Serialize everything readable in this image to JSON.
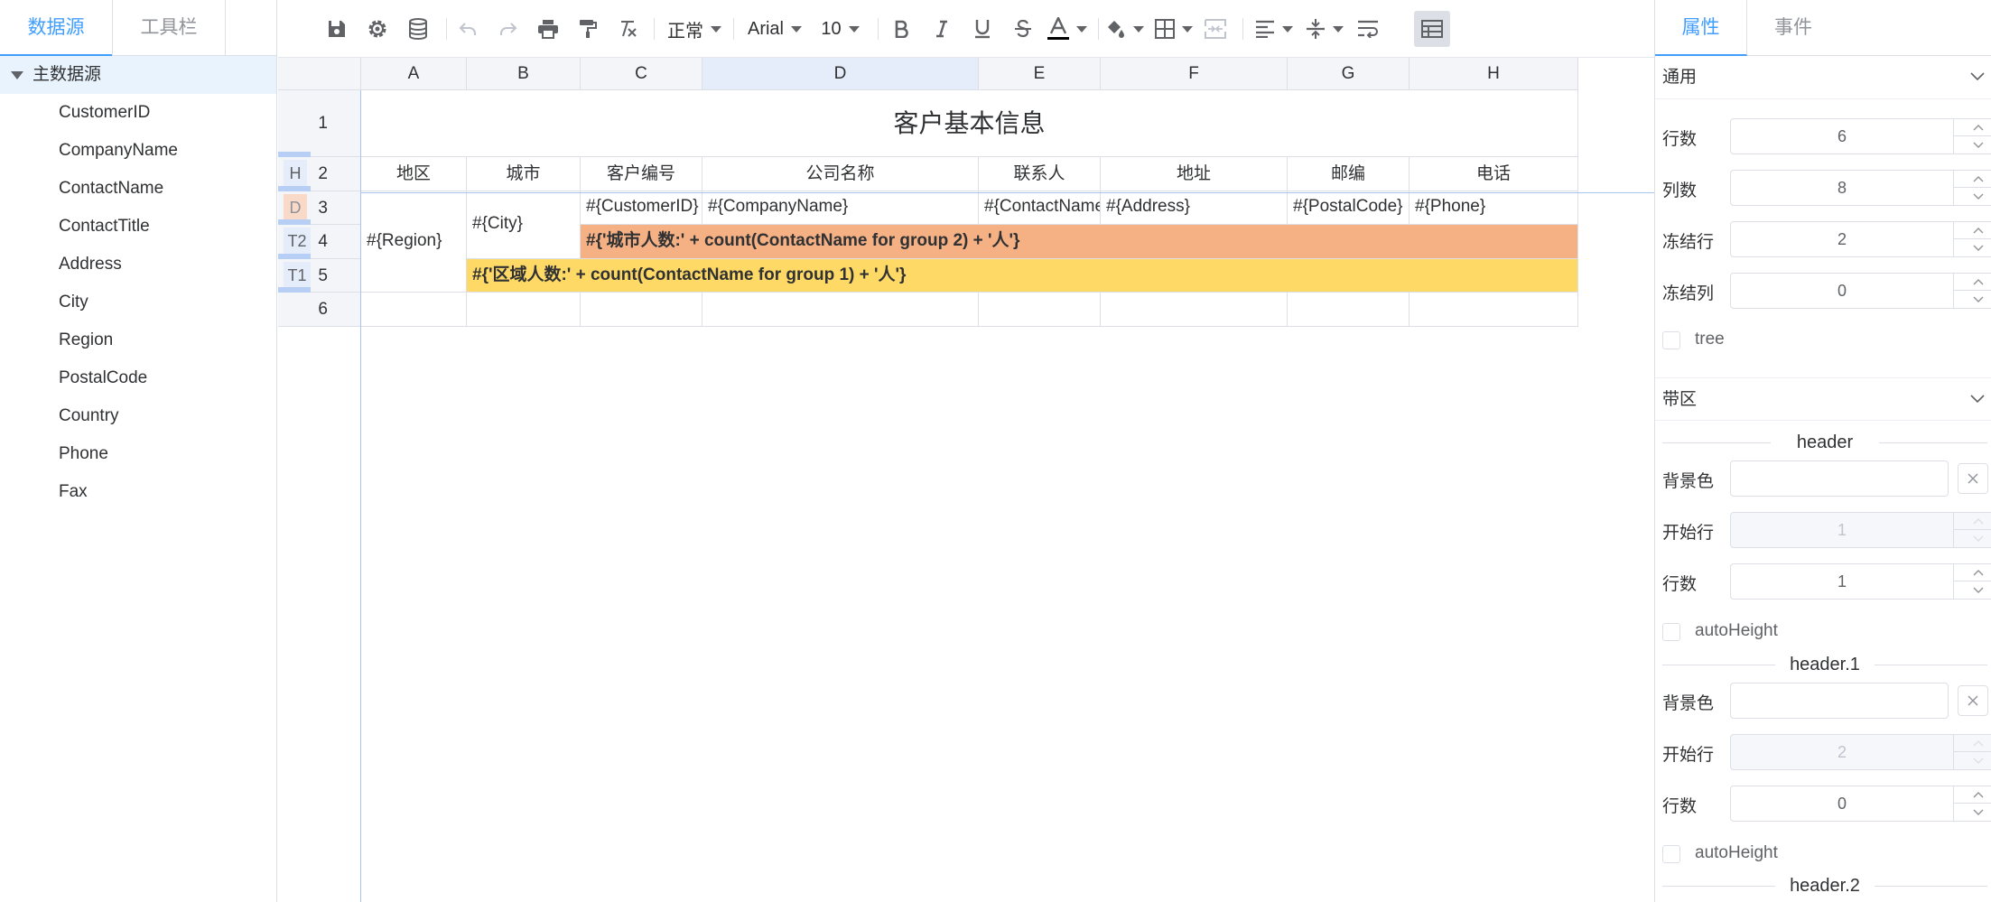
{
  "left_panel": {
    "tabs": [
      "数据源",
      "工具栏"
    ],
    "tree_root": "主数据源",
    "fields": [
      "CustomerID",
      "CompanyName",
      "ContactName",
      "ContactTitle",
      "Address",
      "City",
      "Region",
      "PostalCode",
      "Country",
      "Phone",
      "Fax"
    ]
  },
  "toolbar": {
    "format": "正常",
    "font": "Arial",
    "font_size": "10",
    "font_color": "#000000"
  },
  "sheet": {
    "columns": [
      "A",
      "B",
      "C",
      "D",
      "E",
      "F",
      "G",
      "H"
    ],
    "rows": [
      "1",
      "2",
      "3",
      "4",
      "5",
      "6"
    ],
    "bands": {
      "r2": "H",
      "r3": "D",
      "r4": "T2",
      "r5": "T1"
    },
    "title": "客户基本信息",
    "headers": [
      "地区",
      "城市",
      "客户编号",
      "公司名称",
      "联系人",
      "地址",
      "邮编",
      "电话"
    ],
    "detail": {
      "region": "#{Region}",
      "city": "#{City}",
      "customer_id": "#{CustomerID}",
      "company": "#{CompanyName}",
      "contact": "#{ContactName}",
      "address": "#{Address}",
      "postal": "#{PostalCode}",
      "phone": "#{Phone}"
    },
    "group2_total": "#{'城市人数:' + count(ContactName for group 2) + '人'}",
    "group1_total": "#{'区域人数:' + count(ContactName for group 1) + '人'}",
    "colors": {
      "group2_bg": "#f5b084",
      "group1_bg": "#ffd966",
      "band_d": "#f9d9c8"
    }
  },
  "right_panel": {
    "tabs": [
      "属性",
      "事件"
    ],
    "general": {
      "title": "通用",
      "rows_label": "行数",
      "rows_value": "6",
      "cols_label": "列数",
      "cols_value": "8",
      "frozen_rows_label": "冻结行",
      "frozen_rows_value": "2",
      "frozen_cols_label": "冻结列",
      "frozen_cols_value": "0",
      "tree_label": "tree"
    },
    "bands": {
      "title": "带区",
      "header": {
        "name": "header",
        "bg_label": "背景色",
        "start_label": "开始行",
        "start_value": "1",
        "rows_label": "行数",
        "rows_value": "1",
        "auto_label": "autoHeight"
      },
      "header1": {
        "name": "header.1",
        "bg_label": "背景色",
        "start_label": "开始行",
        "start_value": "2",
        "rows_label": "行数",
        "rows_value": "0",
        "auto_label": "autoHeight"
      },
      "header2": {
        "name": "header.2"
      }
    }
  }
}
